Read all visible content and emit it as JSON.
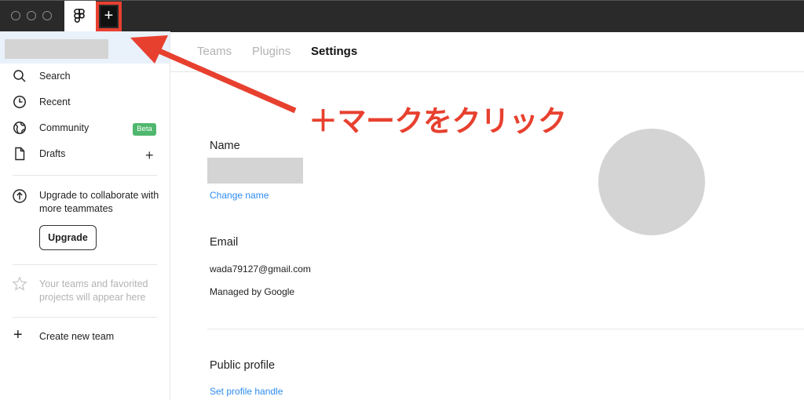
{
  "titlebar": {
    "home_icon": "figma-logo-icon",
    "new_tab_label": "+"
  },
  "sidebar": {
    "items": [
      {
        "label": "Search",
        "icon": "search-icon"
      },
      {
        "label": "Recent",
        "icon": "clock-icon"
      },
      {
        "label": "Community",
        "icon": "globe-icon",
        "badge": "Beta"
      },
      {
        "label": "Drafts",
        "icon": "file-icon",
        "action": "+"
      }
    ],
    "upgrade": {
      "text": "Upgrade to collaborate with more teammates",
      "button_label": "Upgrade"
    },
    "teams_empty": "Your teams and favorited projects will appear here",
    "create_team_label": "Create new team",
    "create_team_icon": "+"
  },
  "tabs": [
    {
      "label": "Teams",
      "active": false
    },
    {
      "label": "Plugins",
      "active": false
    },
    {
      "label": "Settings",
      "active": true
    }
  ],
  "settings": {
    "name_heading": "Name",
    "change_name_link": "Change name",
    "email_heading": "Email",
    "email_value": "wada79127@gmail.com",
    "managed_by": "Managed by Google",
    "public_profile_heading": "Public profile",
    "set_handle_link": "Set profile handle"
  },
  "annotation": {
    "text": "＋マークをクリック",
    "color": "#e8402f"
  },
  "colors": {
    "titlebar": "#2a2a2a",
    "sidebar_selected": "#e9f1fb",
    "beta_badge": "#4fb86e",
    "link": "#2d8cf0",
    "placeholder": "#d4d4d4"
  }
}
